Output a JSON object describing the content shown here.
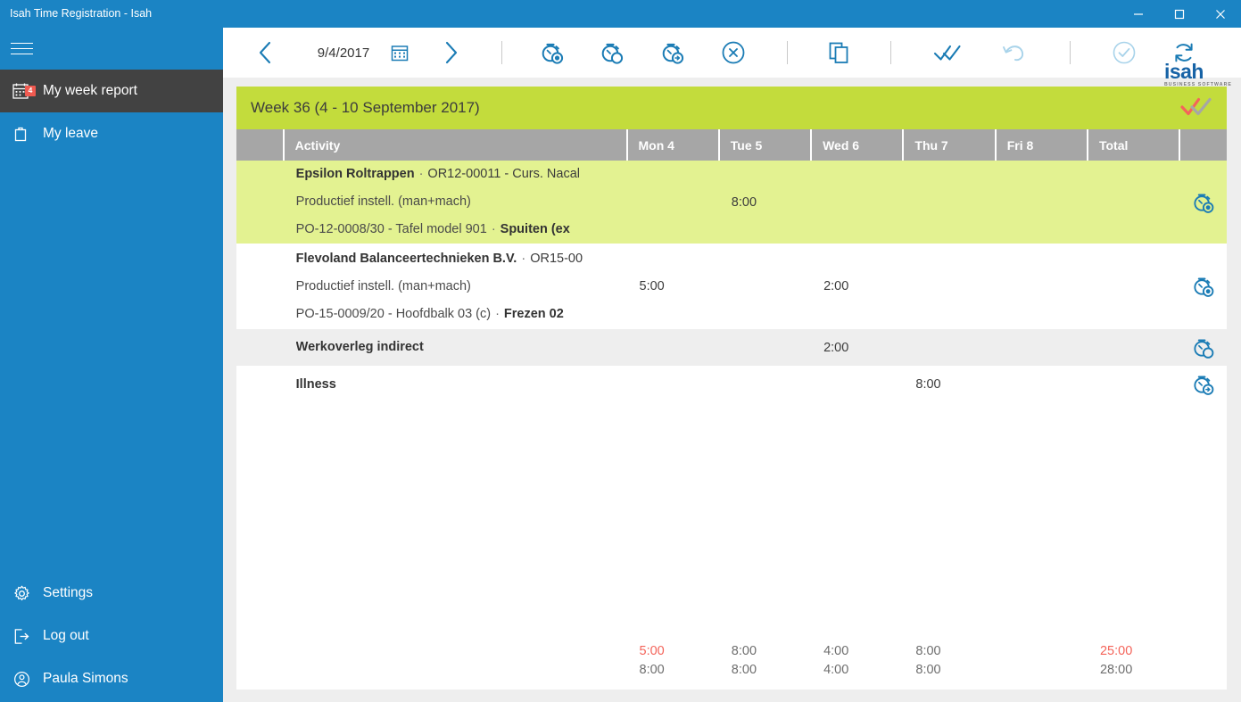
{
  "window": {
    "title": "Isah Time Registration - Isah",
    "minimize_label": "Minimize",
    "maximize_label": "Maximize",
    "close_label": "Close",
    "accent_color": "#1b84c4"
  },
  "sidebar": {
    "menu_label": "Menu",
    "items": [
      {
        "label": "My week report",
        "icon": "calendar-icon",
        "badge": "4",
        "active": true
      },
      {
        "label": "My leave",
        "icon": "briefcase-icon",
        "badge": "",
        "active": false
      }
    ],
    "bottom_items": [
      {
        "label": "Settings",
        "icon": "gear-icon"
      },
      {
        "label": "Log out",
        "icon": "logout-icon"
      },
      {
        "label": "Paula Simons",
        "icon": "user-icon"
      }
    ]
  },
  "toolbar": {
    "prev_label": "Previous week",
    "date": "9/4/2017",
    "calendar_label": "Pick date",
    "next_label": "Next week",
    "start_timer_label": "Start time registration",
    "stop_timer_label": "Stop time registration",
    "transfer_timer_label": "Transfer time registration",
    "cancel_label": "Cancel",
    "copy_label": "Copy week",
    "approve_all_label": "Approve all",
    "undo_label": "Undo",
    "submit_label": "Submit",
    "refresh_label": "Refresh",
    "logo_mark": "isah",
    "logo_sub": "BUSINESS SOFTWARE"
  },
  "week": {
    "title": "Week 36 (4 - 10 September 2017)",
    "approved_label": "Week approved",
    "header_color": "#c3dc3c"
  },
  "table": {
    "columns": [
      "",
      "Activity",
      "Mon 4",
      "Tue 5",
      "Wed 6",
      "Thu 7",
      "Fri 8",
      "Total",
      ""
    ],
    "rows": [
      {
        "style": "green",
        "line1_bold": "Epsilon Roltrappen",
        "line1_rest": "OR12-00011 - Curs. Nacal",
        "line2": "Productief instell. (man+mach)",
        "line3_plain": "PO-12-0008/30 - Tafel model 901",
        "line3_bold": "Spuiten (ex",
        "mon": "",
        "tue": "8:00",
        "wed": "",
        "thu": "",
        "fri": "",
        "total": "",
        "action_icon": "stopwatch-start-icon"
      },
      {
        "style": "white",
        "line1_bold": "Flevoland Balanceertechnieken B.V.",
        "line1_rest": "OR15-00",
        "line2": "Productief instell. (man+mach)",
        "line3_plain": "PO-15-0009/20 - Hoofdbalk 03 (c)",
        "line3_bold": "Frezen 02",
        "mon": "5:00",
        "tue": "",
        "wed": "2:00",
        "thu": "",
        "fri": "",
        "total": "",
        "action_icon": "stopwatch-start-icon"
      },
      {
        "style": "grey",
        "line1_bold": "Werkoverleg indirect",
        "line1_rest": "",
        "line2": "",
        "line3_plain": "",
        "line3_bold": "",
        "mon": "",
        "tue": "",
        "wed": "2:00",
        "thu": "",
        "fri": "",
        "total": "",
        "action_icon": "stopwatch-icon"
      },
      {
        "style": "white",
        "line1_bold": "Illness",
        "line1_rest": "",
        "line2": "",
        "line3_plain": "",
        "line3_bold": "",
        "mon": "",
        "tue": "",
        "wed": "",
        "thu": "8:00",
        "fri": "",
        "total": "",
        "action_icon": "stopwatch-transfer-icon"
      }
    ],
    "totals_primary": {
      "mon": "5:00",
      "tue": "8:00",
      "wed": "4:00",
      "thu": "8:00",
      "fri": "",
      "total": "25:00",
      "color": "#f4645a"
    },
    "totals_secondary": {
      "mon": "8:00",
      "tue": "8:00",
      "wed": "4:00",
      "thu": "8:00",
      "fri": "",
      "total": "28:00",
      "color": "#6e6e6e"
    }
  }
}
